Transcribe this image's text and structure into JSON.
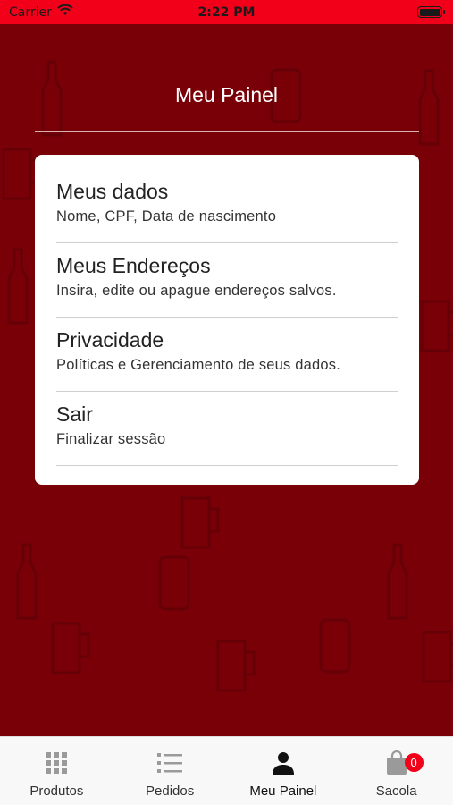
{
  "status_bar": {
    "carrier": "Carrier",
    "time": "2:22 PM"
  },
  "header": {
    "title": "Meu Painel"
  },
  "menu": {
    "items": [
      {
        "title": "Meus dados",
        "subtitle": "Nome, CPF, Data de nascimento"
      },
      {
        "title": "Meus Endereços",
        "subtitle": "Insira, edite ou apague endereços salvos."
      },
      {
        "title": "Privacidade",
        "subtitle": "Políticas e Gerenciamento de seus dados."
      },
      {
        "title": "Sair",
        "subtitle": "Finalizar sessão"
      }
    ]
  },
  "tab_bar": {
    "tabs": [
      {
        "label": "Produtos",
        "icon": "grid-icon"
      },
      {
        "label": "Pedidos",
        "icon": "list-icon"
      },
      {
        "label": "Meu Painel",
        "icon": "person-icon"
      },
      {
        "label": "Sacola",
        "icon": "shopping-bag-icon"
      }
    ],
    "active_tab": "Meu Painel",
    "bag_count": "0"
  },
  "colors": {
    "status_bar": "#f2001a",
    "background": "#7a0008",
    "badge": "#f2001a",
    "tab_inactive": "#9a9a9a",
    "tab_active": "#111111"
  }
}
